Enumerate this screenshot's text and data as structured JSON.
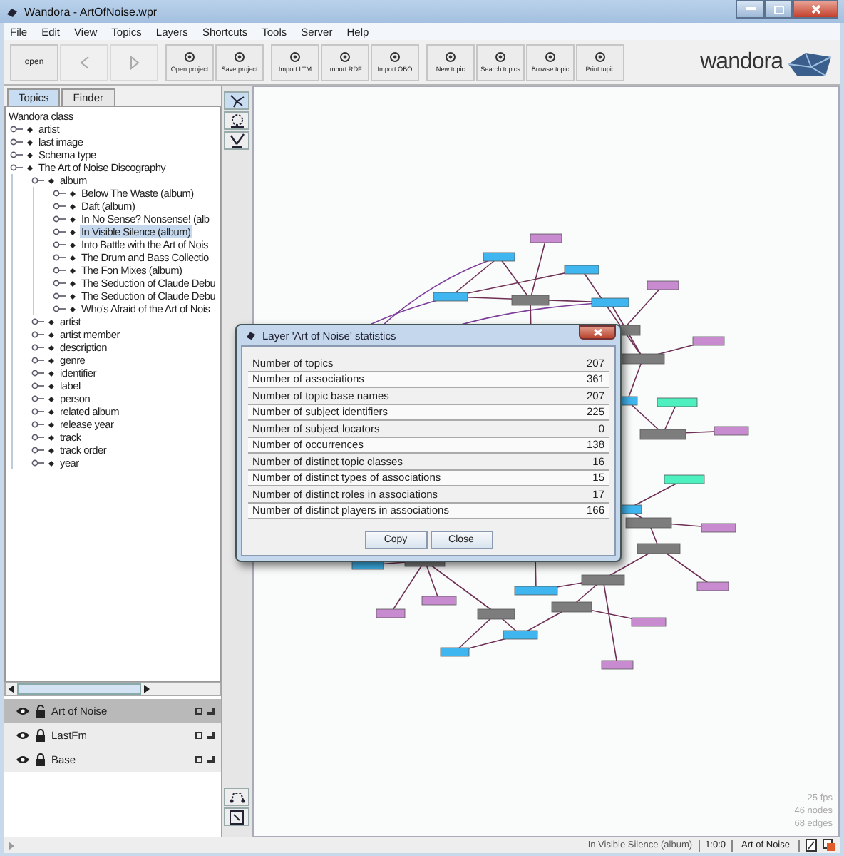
{
  "window": {
    "title": "Wandora - ArtOfNoise.wpr"
  },
  "menu": [
    "File",
    "Edit",
    "View",
    "Topics",
    "Layers",
    "Shortcuts",
    "Tools",
    "Server",
    "Help"
  ],
  "toolbar": [
    [
      {
        "kind": "text",
        "label": "open",
        "disabled": false
      },
      {
        "kind": "back",
        "disabled": true
      },
      {
        "kind": "forward",
        "disabled": true
      }
    ],
    [
      {
        "kind": "labeled",
        "label": "Open project",
        "disabled": false
      },
      {
        "kind": "labeled",
        "label": "Save project",
        "disabled": false
      }
    ],
    [
      {
        "kind": "labeled",
        "label": "Import LTM",
        "disabled": false
      },
      {
        "kind": "labeled",
        "label": "Import RDF",
        "disabled": false
      },
      {
        "kind": "labeled",
        "label": "Import OBO",
        "disabled": false
      }
    ],
    [
      {
        "kind": "labeled",
        "label": "New topic",
        "disabled": false
      },
      {
        "kind": "labeled",
        "label": "Search topics",
        "disabled": false
      },
      {
        "kind": "labeled",
        "label": "Browse topic",
        "disabled": false
      },
      {
        "kind": "labeled",
        "label": "Print topic",
        "disabled": false
      }
    ]
  ],
  "logo": {
    "text": "wandora"
  },
  "left_panel": {
    "tabs": [
      {
        "label": "Topics",
        "selected": true
      },
      {
        "label": "Finder",
        "selected": false
      }
    ],
    "tree": {
      "label": "Wandora class",
      "selected": false,
      "children": [
        {
          "label": "artist",
          "selected": false
        },
        {
          "label": "last image",
          "selected": false
        },
        {
          "label": "Schema type",
          "selected": false
        },
        {
          "label": "The Art of Noise Discography",
          "selected": false,
          "children": [
            {
              "label": "album",
              "selected": false,
              "children": [
                {
                  "label": "Below The Waste (album)",
                  "selected": false
                },
                {
                  "label": "Daft (album)",
                  "selected": false
                },
                {
                  "label": "In No Sense? Nonsense! (alb",
                  "selected": false
                },
                {
                  "label": "In Visible Silence (album)",
                  "selected": true
                },
                {
                  "label": "Into Battle with the Art of Nois",
                  "selected": false
                },
                {
                  "label": "The Drum and Bass Collectio",
                  "selected": false
                },
                {
                  "label": "The Fon Mixes (album)",
                  "selected": false
                },
                {
                  "label": "The Seduction of Claude Debu",
                  "selected": false
                },
                {
                  "label": "The Seduction of Claude Debu",
                  "selected": false
                },
                {
                  "label": "Who's Afraid of the Art of Nois",
                  "selected": false
                }
              ]
            },
            {
              "label": "artist",
              "selected": false
            },
            {
              "label": "artist member",
              "selected": false
            },
            {
              "label": "description",
              "selected": false
            },
            {
              "label": "genre",
              "selected": false
            },
            {
              "label": "identifier",
              "selected": false
            },
            {
              "label": "label",
              "selected": false
            },
            {
              "label": "person",
              "selected": false
            },
            {
              "label": "related album",
              "selected": false
            },
            {
              "label": "release year",
              "selected": false
            },
            {
              "label": "track",
              "selected": false
            },
            {
              "label": "track order",
              "selected": false
            },
            {
              "label": "year",
              "selected": false
            }
          ]
        }
      ]
    },
    "layers": [
      {
        "name": "Art of Noise",
        "selected": true,
        "locked": false
      },
      {
        "name": "LastFm",
        "selected": false,
        "locked": true
      },
      {
        "name": "Base",
        "selected": false,
        "locked": true
      }
    ]
  },
  "canvas_tools": [
    {
      "selected": true
    },
    {
      "selected": false
    },
    {
      "selected": false
    }
  ],
  "graph_stats": [
    "25 fps",
    "46 nodes",
    "68 edges"
  ],
  "dialog": {
    "title": "Layer 'Art of Noise' statistics",
    "rows": [
      {
        "label": "Number of topics",
        "value": "207"
      },
      {
        "label": "Number of associations",
        "value": "361"
      },
      {
        "label": "Number of topic base names",
        "value": "207"
      },
      {
        "label": "Number of subject identifiers",
        "value": "225"
      },
      {
        "label": "Number of subject locators",
        "value": "0"
      },
      {
        "label": "Number of occurrences",
        "value": "138"
      },
      {
        "label": "Number of distinct topic classes",
        "value": "16"
      },
      {
        "label": "Number of distinct types of associations",
        "value": "15"
      },
      {
        "label": "Number of distinct roles in associations",
        "value": "17"
      },
      {
        "label": "Number of distinct players in associations",
        "value": "166"
      }
    ],
    "buttons": [
      "Copy",
      "Close"
    ]
  },
  "status_bar": {
    "topic": "In Visible Silence (album)",
    "zoom": "1:0:0",
    "layer": "Art of Noise"
  }
}
